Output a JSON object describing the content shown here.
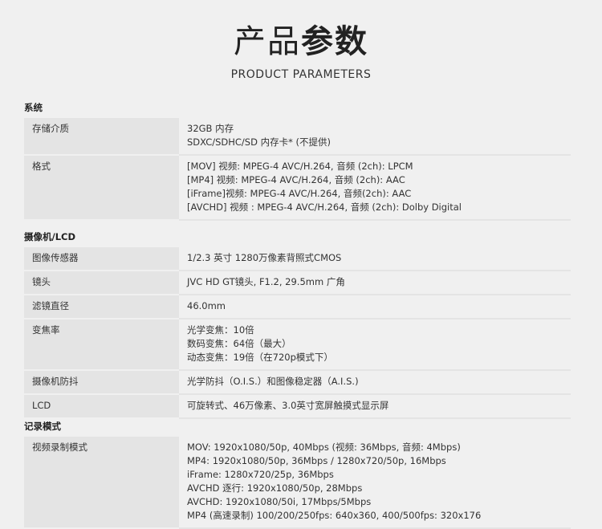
{
  "header": {
    "title_light": "产品",
    "title_bold": "参数",
    "subtitle": "PRODUCT PARAMETERS"
  },
  "sections": [
    {
      "title": "系统",
      "rows": [
        {
          "key": "存储介质",
          "values": [
            "32GB 内存",
            "SDXC/SDHC/SD 内存卡* (不提供)"
          ]
        },
        {
          "key": "格式",
          "values": [
            "[MOV] 视频: MPEG-4 AVC/H.264, 音频 (2ch): LPCM",
            "[MP4] 视频: MPEG-4 AVC/H.264, 音频 (2ch): AAC",
            "[iFrame]视频: MPEG-4 AVC/H.264, 音频(2ch): AAC",
            "[AVCHD] 视频 : MPEG-4 AVC/H.264, 音频 (2ch): Dolby Digital"
          ]
        }
      ]
    },
    {
      "title": "摄像机/LCD",
      "rows": [
        {
          "key": "图像传感器",
          "values": [
            "1/2.3 英寸 1280万像素背照式CMOS"
          ]
        },
        {
          "key": "镜头",
          "values": [
            "JVC HD GT镜头, F1.2, 29.5mm 广角"
          ]
        },
        {
          "key": "滤镜直径",
          "values": [
            "46.0mm"
          ]
        },
        {
          "key": "变焦率",
          "values": [
            "光学变焦：10倍",
            "数码变焦：64倍（最大）",
            "动态变焦：19倍（在720p模式下）"
          ]
        },
        {
          "key": "摄像机防抖",
          "values": [
            "光学防抖（O.I.S.）和图像稳定器（A.I.S.)"
          ]
        },
        {
          "key": "LCD",
          "values": [
            "可旋转式、46万像素、3.0英寸宽屏触摸式显示屏"
          ]
        }
      ]
    },
    {
      "title": "记录模式",
      "rows": [
        {
          "key": "视频录制模式",
          "values": [
            "MOV: 1920x1080/50p, 40Mbps (视频: 36Mbps, 音频: 4Mbps)",
            "MP4: 1920x1080/50p, 36Mbps / 1280x720/50p, 16Mbps",
            "iFrame: 1280x720/25p, 36Mbps",
            "AVCHD 逐行: 1920x1080/50p, 28Mbps",
            "AVCHD: 1920x1080/50i, 17Mbps/5Mbps",
            "MP4 (高速录制) 100/200/250fps: 640x360, 400/500fps: 320x176"
          ]
        }
      ]
    }
  ]
}
